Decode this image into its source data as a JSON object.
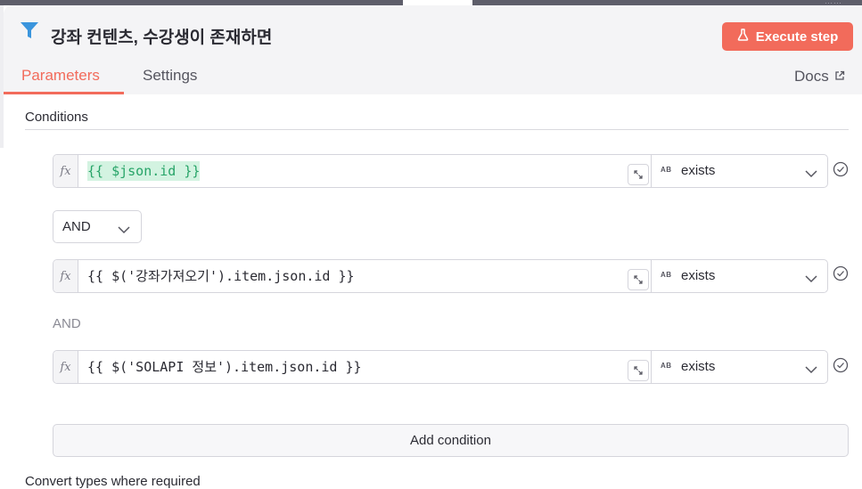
{
  "node": {
    "title": "강좌 컨텐츠, 수강생이 존재하면",
    "icon": "filter-icon"
  },
  "toolbar": {
    "execute_label": "Execute step",
    "execute_icon": "flask-icon"
  },
  "tabs": [
    {
      "label": "Parameters",
      "active": true
    },
    {
      "label": "Settings",
      "active": false
    }
  ],
  "docs": {
    "label": "Docs",
    "icon": "external-link-icon"
  },
  "conditions": {
    "heading": "Conditions",
    "rows": [
      {
        "fx": "fx",
        "expression": "{{ $json.id }}",
        "type_badge": "AB",
        "operator": "exists"
      },
      {
        "fx": "fx",
        "expression": "{{ $('강좌가져오기').item.json.id }}",
        "type_badge": "AB",
        "operator": "exists"
      },
      {
        "fx": "fx",
        "expression": "{{ $('SOLAPI 정보').item.json.id }}",
        "type_badge": "AB",
        "operator": "exists"
      }
    ],
    "combinator_select": "AND",
    "combinator_text": "AND",
    "add_label": "Add condition"
  },
  "options": {
    "convert_types_label": "Convert types where required"
  },
  "colors": {
    "accent": "#f26b5b",
    "expression_highlight": "#d3f3e1",
    "expression_text": "#27a468",
    "header_bg": "#f4f4f6"
  }
}
